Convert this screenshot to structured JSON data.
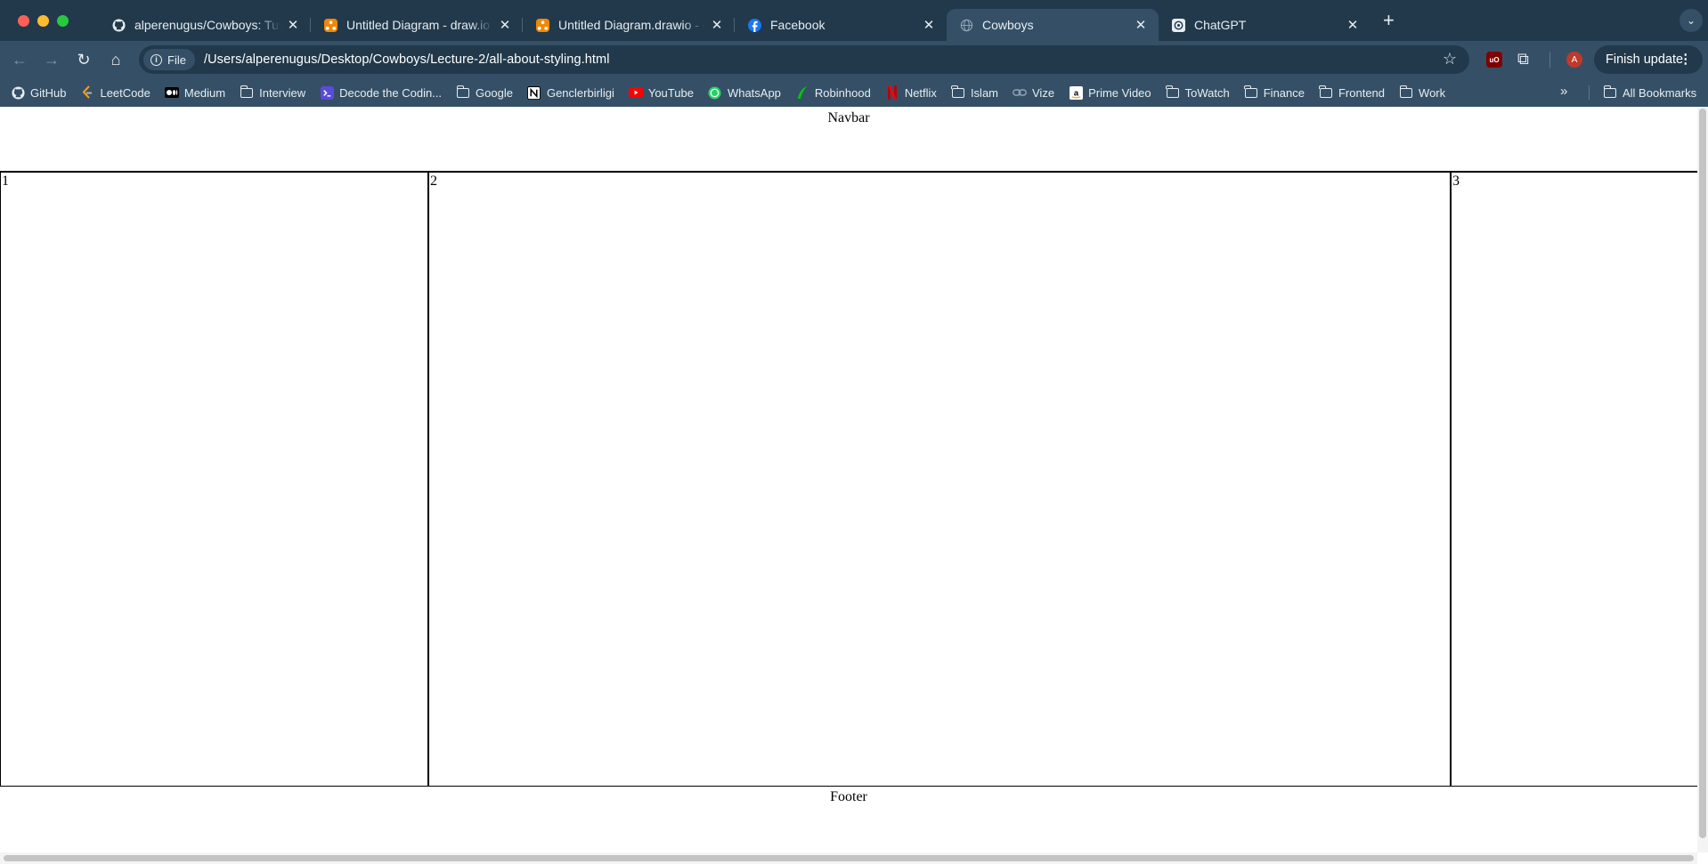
{
  "tabs": [
    {
      "title": "alperenugus/Cowboys: Tutorial",
      "favicon": "github-icon",
      "active": false
    },
    {
      "title": "Untitled Diagram - draw.io",
      "favicon": "drawio-icon",
      "active": false
    },
    {
      "title": "Untitled Diagram.drawio - draw.io",
      "favicon": "drawio-icon",
      "active": false
    },
    {
      "title": "Facebook",
      "favicon": "facebook-icon",
      "active": false
    },
    {
      "title": "Cowboys",
      "favicon": "globe-icon",
      "active": true
    },
    {
      "title": "ChatGPT",
      "favicon": "chatgpt-icon",
      "active": false
    }
  ],
  "toolbar": {
    "site_chip": "File",
    "url": "/Users/alperenugus/Desktop/Cowboys/Lecture-2/all-about-styling.html",
    "finish_update": "Finish update",
    "avatar_letter": "A"
  },
  "bookmarks": [
    {
      "label": "GitHub",
      "icon": "github-icon"
    },
    {
      "label": "LeetCode",
      "icon": "leetcode-icon"
    },
    {
      "label": "Medium",
      "icon": "medium-icon"
    },
    {
      "label": "Interview",
      "icon": "folder-icon"
    },
    {
      "label": "Decode the Codin...",
      "icon": "terminal-icon"
    },
    {
      "label": "Google",
      "icon": "folder-icon"
    },
    {
      "label": "Genclerbirligi",
      "icon": "notion-icon"
    },
    {
      "label": "YouTube",
      "icon": "youtube-icon"
    },
    {
      "label": "WhatsApp",
      "icon": "whatsapp-icon"
    },
    {
      "label": "Robinhood",
      "icon": "robinhood-icon"
    },
    {
      "label": "Netflix",
      "icon": "netflix-icon"
    },
    {
      "label": "Islam",
      "icon": "folder-icon"
    },
    {
      "label": "Vize",
      "icon": "link-icon"
    },
    {
      "label": "Prime Video",
      "icon": "amazon-icon"
    },
    {
      "label": "ToWatch",
      "icon": "folder-icon"
    },
    {
      "label": "Finance",
      "icon": "folder-icon"
    },
    {
      "label": "Frontend",
      "icon": "folder-icon"
    },
    {
      "label": "Work",
      "icon": "folder-icon"
    }
  ],
  "all_bookmarks": "All Bookmarks",
  "page": {
    "navbar": "Navbar",
    "col1": "1",
    "col2": "2",
    "col3": "3",
    "footer": "Footer"
  },
  "colors": {
    "chrome_dark": "#21394b",
    "chrome_light": "#355066"
  }
}
